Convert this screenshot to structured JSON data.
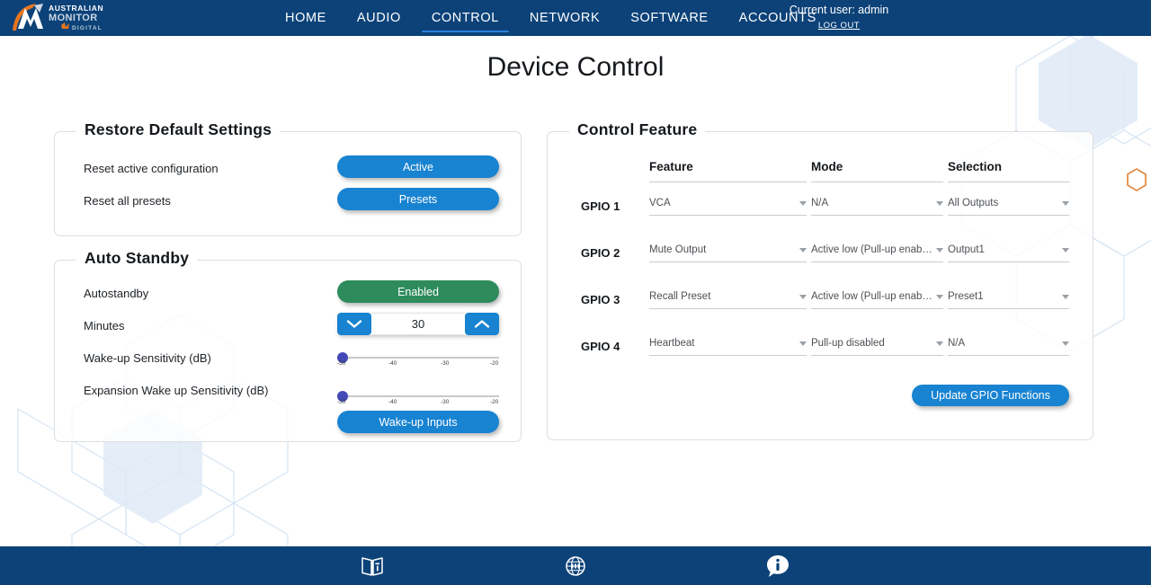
{
  "header": {
    "logo_line1": "AUSTRALIAN",
    "logo_line2": "MONITOR",
    "logo_line3": "DIGITAL",
    "nav": [
      {
        "label": "HOME",
        "active": false
      },
      {
        "label": "AUDIO",
        "active": false
      },
      {
        "label": "CONTROL",
        "active": true
      },
      {
        "label": "NETWORK",
        "active": false
      },
      {
        "label": "SOFTWARE",
        "active": false
      },
      {
        "label": "ACCOUNTS",
        "active": false
      }
    ],
    "current_user": "Current user: admin",
    "logout": "LOG OUT",
    "bar_color": "#0c4278",
    "accent_color": "#2f80d8"
  },
  "page": {
    "title": "Device Control"
  },
  "restore_defaults": {
    "legend": "Restore Default Settings",
    "rows": [
      {
        "label": "Reset active configuration",
        "button": "Active"
      },
      {
        "label": "Reset all presets",
        "button": "Presets"
      }
    ]
  },
  "auto_standby": {
    "legend": "Auto Standby",
    "autostandby_label": "Autostandby",
    "autostandby_state": "Enabled",
    "minutes_label": "Minutes",
    "minutes_value": "30",
    "decrement_icon": "chevron-down-icon",
    "increment_icon": "chevron-up-icon",
    "wakeup_label": "Wake-up Sensitivity (dB)",
    "expansion_label": "Expansion Wake up Sensitivity (dB)",
    "slider_ticks": [
      "-50",
      "-40",
      "-30",
      "-20"
    ],
    "slider_min": -50,
    "slider_max": -20,
    "wakeup_value": -50,
    "expansion_value": -50,
    "wakeup_inputs_button": "Wake-up Inputs",
    "enabled_color": "#2e8b5c",
    "button_color": "#1883d1"
  },
  "control_feature": {
    "legend": "Control Feature",
    "columns": [
      "Feature",
      "Mode",
      "Selection"
    ],
    "rows": [
      {
        "gpio": "GPIO 1",
        "feature": "VCA",
        "mode": "N/A",
        "selection": "All Outputs"
      },
      {
        "gpio": "GPIO 2",
        "feature": "Mute Output",
        "mode": "Active low (Pull-up enabled)",
        "selection": "Output1"
      },
      {
        "gpio": "GPIO 3",
        "feature": "Recall Preset",
        "mode": "Active low (Pull-up enabled)",
        "selection": "Preset1"
      },
      {
        "gpio": "GPIO 4",
        "feature": "Heartbeat",
        "mode": "Pull-up disabled",
        "selection": "N/A"
      }
    ],
    "update_button": "Update GPIO Functions"
  },
  "footer": {
    "icons": [
      {
        "name": "manual-book-icon"
      },
      {
        "name": "globe-web-icon"
      },
      {
        "name": "info-bubble-icon"
      }
    ],
    "bar_color": "#0c4278"
  }
}
